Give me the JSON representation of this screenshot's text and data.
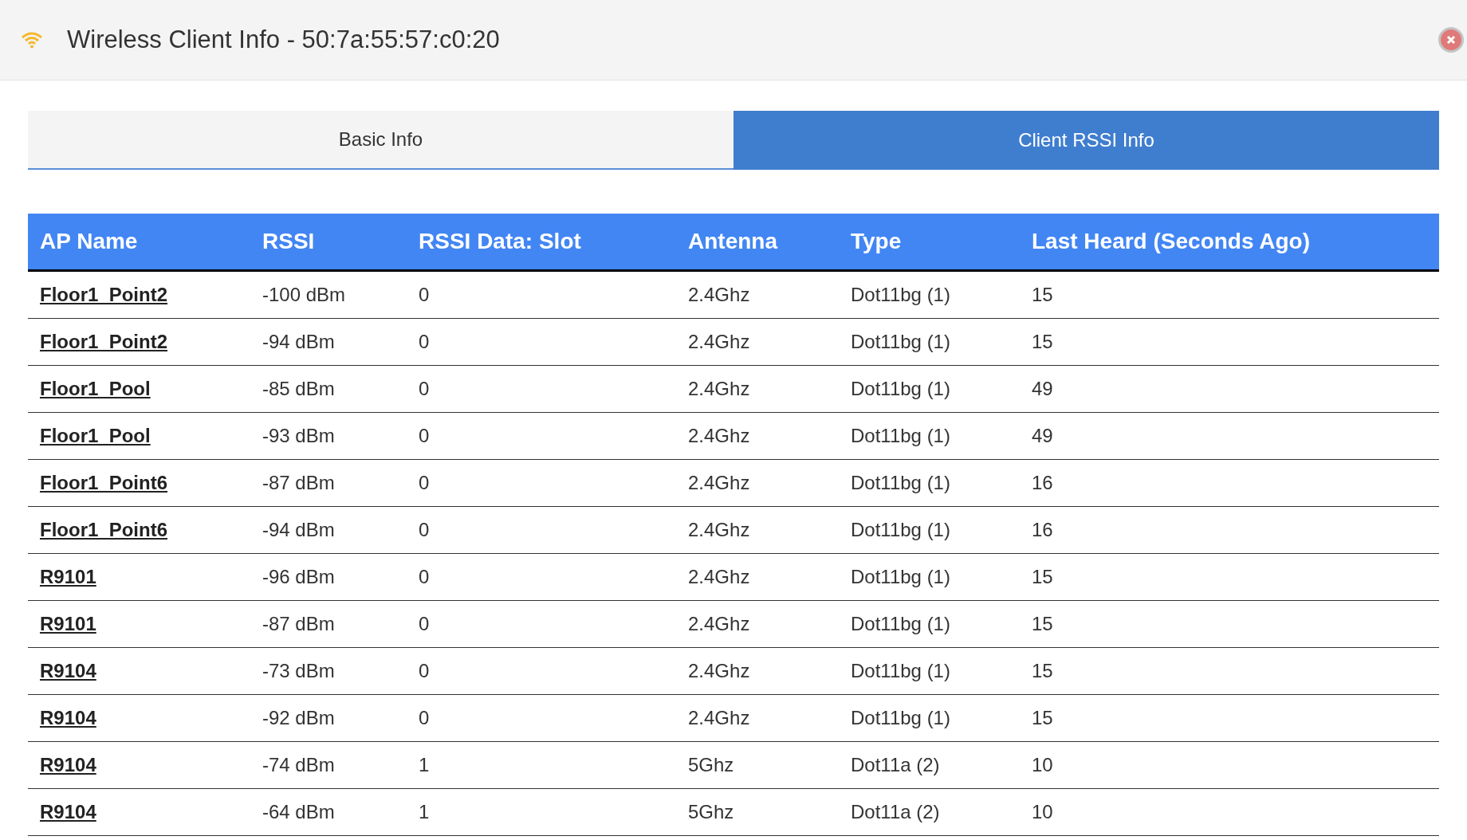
{
  "window": {
    "title": "Wireless Client Info - 50:7a:55:57:c0:20"
  },
  "tabs": [
    {
      "label": "Basic Info",
      "selected": false
    },
    {
      "label": "Client RSSI Info",
      "selected": true
    }
  ],
  "table": {
    "columns": [
      "AP Name",
      "RSSI",
      "RSSI Data: Slot",
      "Antenna",
      "Type",
      "Last Heard (Seconds Ago)"
    ],
    "rows": [
      [
        "Floor1_Point2",
        "-100 dBm",
        "0",
        "2.4Ghz",
        "Dot11bg (1)",
        "15"
      ],
      [
        "Floor1_Point2",
        "-94 dBm",
        "0",
        "2.4Ghz",
        "Dot11bg (1)",
        "15"
      ],
      [
        "Floor1_Pool",
        "-85 dBm",
        "0",
        "2.4Ghz",
        "Dot11bg (1)",
        "49"
      ],
      [
        "Floor1_Pool",
        "-93 dBm",
        "0",
        "2.4Ghz",
        "Dot11bg (1)",
        "49"
      ],
      [
        "Floor1_Point6",
        "-87 dBm",
        "0",
        "2.4Ghz",
        "Dot11bg (1)",
        "16"
      ],
      [
        "Floor1_Point6",
        "-94 dBm",
        "0",
        "2.4Ghz",
        "Dot11bg (1)",
        "16"
      ],
      [
        "R9101",
        "-96 dBm",
        "0",
        "2.4Ghz",
        "Dot11bg (1)",
        "15"
      ],
      [
        "R9101",
        "-87 dBm",
        "0",
        "2.4Ghz",
        "Dot11bg (1)",
        "15"
      ],
      [
        "R9104",
        "-73 dBm",
        "0",
        "2.4Ghz",
        "Dot11bg (1)",
        "15"
      ],
      [
        "R9104",
        "-92 dBm",
        "0",
        "2.4Ghz",
        "Dot11bg (1)",
        "15"
      ],
      [
        "R9104",
        "-74 dBm",
        "1",
        "5Ghz",
        "Dot11a (2)",
        "10"
      ],
      [
        "R9104",
        "-64 dBm",
        "1",
        "5Ghz",
        "Dot11a (2)",
        "10"
      ]
    ]
  }
}
